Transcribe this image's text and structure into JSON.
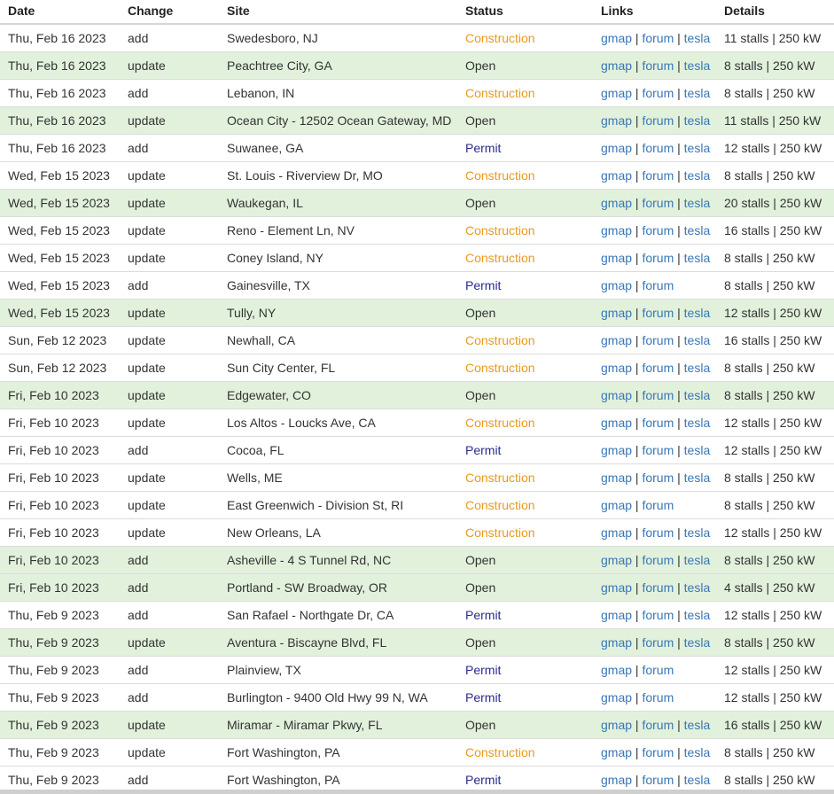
{
  "headers": {
    "date": "Date",
    "change": "Change",
    "site": "Site",
    "status": "Status",
    "links": "Links",
    "details": "Details"
  },
  "link_labels": {
    "gmap": "gmap",
    "forum": "forum",
    "tesla": "tesla",
    "separator": "|"
  },
  "colors": {
    "open_row_bg": "#e2f1dc",
    "construction": "#e89a1c",
    "permit": "#2b2b8f",
    "link": "#3a76b5"
  },
  "rows": [
    {
      "date": "Thu, Feb 16 2023",
      "change": "add",
      "site": "Swedesboro, NJ",
      "status": "Construction",
      "tesla": true,
      "details": "11 stalls | 250 kW"
    },
    {
      "date": "Thu, Feb 16 2023",
      "change": "update",
      "site": "Peachtree City, GA",
      "status": "Open",
      "tesla": true,
      "details": "8 stalls | 250 kW"
    },
    {
      "date": "Thu, Feb 16 2023",
      "change": "add",
      "site": "Lebanon, IN",
      "status": "Construction",
      "tesla": true,
      "details": "8 stalls | 250 kW"
    },
    {
      "date": "Thu, Feb 16 2023",
      "change": "update",
      "site": "Ocean City - 12502 Ocean Gateway, MD",
      "status": "Open",
      "tesla": true,
      "details": "11 stalls | 250 kW"
    },
    {
      "date": "Thu, Feb 16 2023",
      "change": "add",
      "site": "Suwanee, GA",
      "status": "Permit",
      "tesla": true,
      "details": "12 stalls | 250 kW"
    },
    {
      "date": "Wed, Feb 15 2023",
      "change": "update",
      "site": "St. Louis - Riverview Dr, MO",
      "status": "Construction",
      "tesla": true,
      "details": "8 stalls | 250 kW"
    },
    {
      "date": "Wed, Feb 15 2023",
      "change": "update",
      "site": "Waukegan, IL",
      "status": "Open",
      "tesla": true,
      "details": "20 stalls | 250 kW"
    },
    {
      "date": "Wed, Feb 15 2023",
      "change": "update",
      "site": "Reno - Element Ln, NV",
      "status": "Construction",
      "tesla": true,
      "details": "16 stalls | 250 kW"
    },
    {
      "date": "Wed, Feb 15 2023",
      "change": "update",
      "site": "Coney Island, NY",
      "status": "Construction",
      "tesla": true,
      "details": "8 stalls | 250 kW"
    },
    {
      "date": "Wed, Feb 15 2023",
      "change": "add",
      "site": "Gainesville, TX",
      "status": "Permit",
      "tesla": false,
      "details": "8 stalls | 250 kW"
    },
    {
      "date": "Wed, Feb 15 2023",
      "change": "update",
      "site": "Tully, NY",
      "status": "Open",
      "tesla": true,
      "details": "12 stalls | 250 kW"
    },
    {
      "date": "Sun, Feb 12 2023",
      "change": "update",
      "site": "Newhall, CA",
      "status": "Construction",
      "tesla": true,
      "details": "16 stalls | 250 kW"
    },
    {
      "date": "Sun, Feb 12 2023",
      "change": "update",
      "site": "Sun City Center, FL",
      "status": "Construction",
      "tesla": true,
      "details": "8 stalls | 250 kW"
    },
    {
      "date": "Fri, Feb 10 2023",
      "change": "update",
      "site": "Edgewater, CO",
      "status": "Open",
      "tesla": true,
      "details": "8 stalls | 250 kW"
    },
    {
      "date": "Fri, Feb 10 2023",
      "change": "update",
      "site": "Los Altos - Loucks Ave, CA",
      "status": "Construction",
      "tesla": true,
      "details": "12 stalls | 250 kW"
    },
    {
      "date": "Fri, Feb 10 2023",
      "change": "add",
      "site": "Cocoa, FL",
      "status": "Permit",
      "tesla": true,
      "details": "12 stalls | 250 kW"
    },
    {
      "date": "Fri, Feb 10 2023",
      "change": "update",
      "site": "Wells, ME",
      "status": "Construction",
      "tesla": true,
      "details": "8 stalls | 250 kW"
    },
    {
      "date": "Fri, Feb 10 2023",
      "change": "update",
      "site": "East Greenwich - Division St, RI",
      "status": "Construction",
      "tesla": false,
      "details": "8 stalls | 250 kW"
    },
    {
      "date": "Fri, Feb 10 2023",
      "change": "update",
      "site": "New Orleans, LA",
      "status": "Construction",
      "tesla": true,
      "details": "12 stalls | 250 kW"
    },
    {
      "date": "Fri, Feb 10 2023",
      "change": "add",
      "site": "Asheville - 4 S Tunnel Rd, NC",
      "status": "Open",
      "tesla": true,
      "details": "8 stalls | 250 kW"
    },
    {
      "date": "Fri, Feb 10 2023",
      "change": "add",
      "site": "Portland - SW Broadway, OR",
      "status": "Open",
      "tesla": true,
      "details": "4 stalls | 250 kW"
    },
    {
      "date": "Thu, Feb 9 2023",
      "change": "add",
      "site": "San Rafael - Northgate Dr, CA",
      "status": "Permit",
      "tesla": true,
      "details": "12 stalls | 250 kW"
    },
    {
      "date": "Thu, Feb 9 2023",
      "change": "update",
      "site": "Aventura - Biscayne Blvd, FL",
      "status": "Open",
      "tesla": true,
      "details": "8 stalls | 250 kW"
    },
    {
      "date": "Thu, Feb 9 2023",
      "change": "add",
      "site": "Plainview, TX",
      "status": "Permit",
      "tesla": false,
      "details": "12 stalls | 250 kW"
    },
    {
      "date": "Thu, Feb 9 2023",
      "change": "add",
      "site": "Burlington - 9400 Old Hwy 99 N, WA",
      "status": "Permit",
      "tesla": false,
      "details": "12 stalls | 250 kW"
    },
    {
      "date": "Thu, Feb 9 2023",
      "change": "update",
      "site": "Miramar - Miramar Pkwy, FL",
      "status": "Open",
      "tesla": true,
      "details": "16 stalls | 250 kW"
    },
    {
      "date": "Thu, Feb 9 2023",
      "change": "update",
      "site": "Fort Washington, PA",
      "status": "Construction",
      "tesla": true,
      "details": "8 stalls | 250 kW"
    },
    {
      "date": "Thu, Feb 9 2023",
      "change": "add",
      "site": "Fort Washington, PA",
      "status": "Permit",
      "tesla": true,
      "details": "8 stalls | 250 kW"
    }
  ]
}
